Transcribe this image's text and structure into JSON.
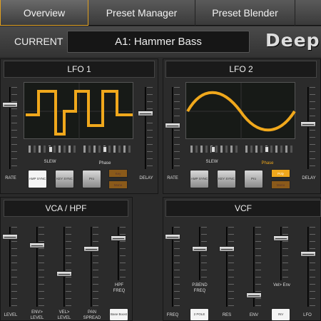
{
  "tabs": [
    "Overview",
    "Preset Manager",
    "Preset Blender"
  ],
  "header": {
    "current_label": "CURRENT",
    "preset_name": "A1: Hammer Bass",
    "logo": "Deep"
  },
  "lfo1": {
    "title": "LFO 1",
    "slew": "SLEW",
    "phase": "Phase",
    "rate": "RATE",
    "delay": "DELAY",
    "buttons": [
      "AMP SYNC",
      "KEY SYNC",
      "Pro"
    ],
    "small_buttons": [
      "Key",
      "Mono"
    ]
  },
  "lfo2": {
    "title": "LFO 2",
    "slew": "SLEW",
    "phase": "Phase",
    "rate": "RATE",
    "delay": "DELAY",
    "buttons": [
      "AMP SYNC",
      "KEY SYNC",
      "Pro"
    ],
    "small_buttons": [
      "Poly",
      "Mono"
    ]
  },
  "vca": {
    "title": "VCA / HPF",
    "labels": [
      "LEVEL",
      "ENV> LEVEL",
      "VEL> LEVEL",
      "PAN SPREAD",
      "HPF FREQ"
    ],
    "button": "Base Boost"
  },
  "vcf": {
    "title": "VCF",
    "labels": [
      "FREQ",
      "P.BEND FREQ",
      "RES",
      "ENV",
      "Vel> Env",
      "LFO"
    ],
    "buttons": [
      "2 POLE",
      "INV"
    ]
  },
  "colors": {
    "accent": "#f0a81c",
    "wave": "#f0a81c",
    "tab_border": "#e0a020"
  },
  "icons": {
    "wave_square": "square-wave-icon",
    "wave_sine": "sine-wave-icon"
  }
}
